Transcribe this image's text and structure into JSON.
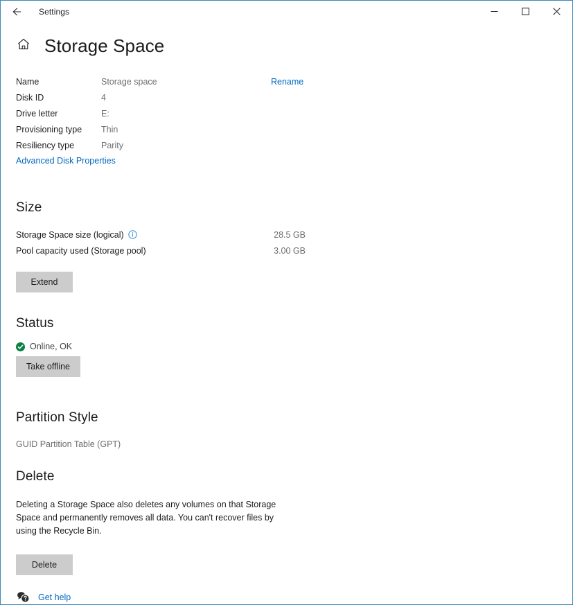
{
  "window": {
    "app_title": "Settings",
    "back_icon": "back-arrow-icon",
    "minimize_label": "Minimize",
    "maximize_label": "Maximize",
    "close_label": "Close",
    "border_color": "#3b87b8"
  },
  "header": {
    "home_icon": "home-icon",
    "title": "Storage Space"
  },
  "properties": {
    "rows": [
      {
        "label": "Name",
        "value": "Storage space",
        "action": "Rename"
      },
      {
        "label": "Disk ID",
        "value": "4",
        "action": ""
      },
      {
        "label": "Drive letter",
        "value": "E:",
        "action": ""
      },
      {
        "label": "Provisioning type",
        "value": "Thin",
        "action": ""
      },
      {
        "label": "Resiliency type",
        "value": "Parity",
        "action": ""
      }
    ],
    "advanced_link": "Advanced Disk Properties"
  },
  "size": {
    "heading": "Size",
    "rows": [
      {
        "label": "Storage Space size (logical)",
        "value": "28.5 GB",
        "info_icon": "info-icon"
      },
      {
        "label": "Pool capacity used (Storage pool)",
        "value": "3.00 GB",
        "info_icon": ""
      }
    ],
    "extend_button": "Extend"
  },
  "status": {
    "heading": "Status",
    "icon": "check-circle-icon",
    "text": "Online, OK",
    "take_offline_button": "Take offline"
  },
  "partition": {
    "heading": "Partition Style",
    "value": "GUID Partition Table (GPT)"
  },
  "delete": {
    "heading": "Delete",
    "description": "Deleting a Storage Space also deletes any volumes on that Storage Space and permanently removes all data. You can't recover files by using the Recycle Bin.",
    "button": "Delete"
  },
  "footer": {
    "help_icon": "help-bubble-icon",
    "help_label": "Get help"
  },
  "colors": {
    "link": "#0069c0",
    "accent_border": "#3b87b8",
    "button_bg": "#cccccc",
    "status_green": "#107c10",
    "info_blue": "#0078d4",
    "muted_text": "#6e6e6e"
  }
}
